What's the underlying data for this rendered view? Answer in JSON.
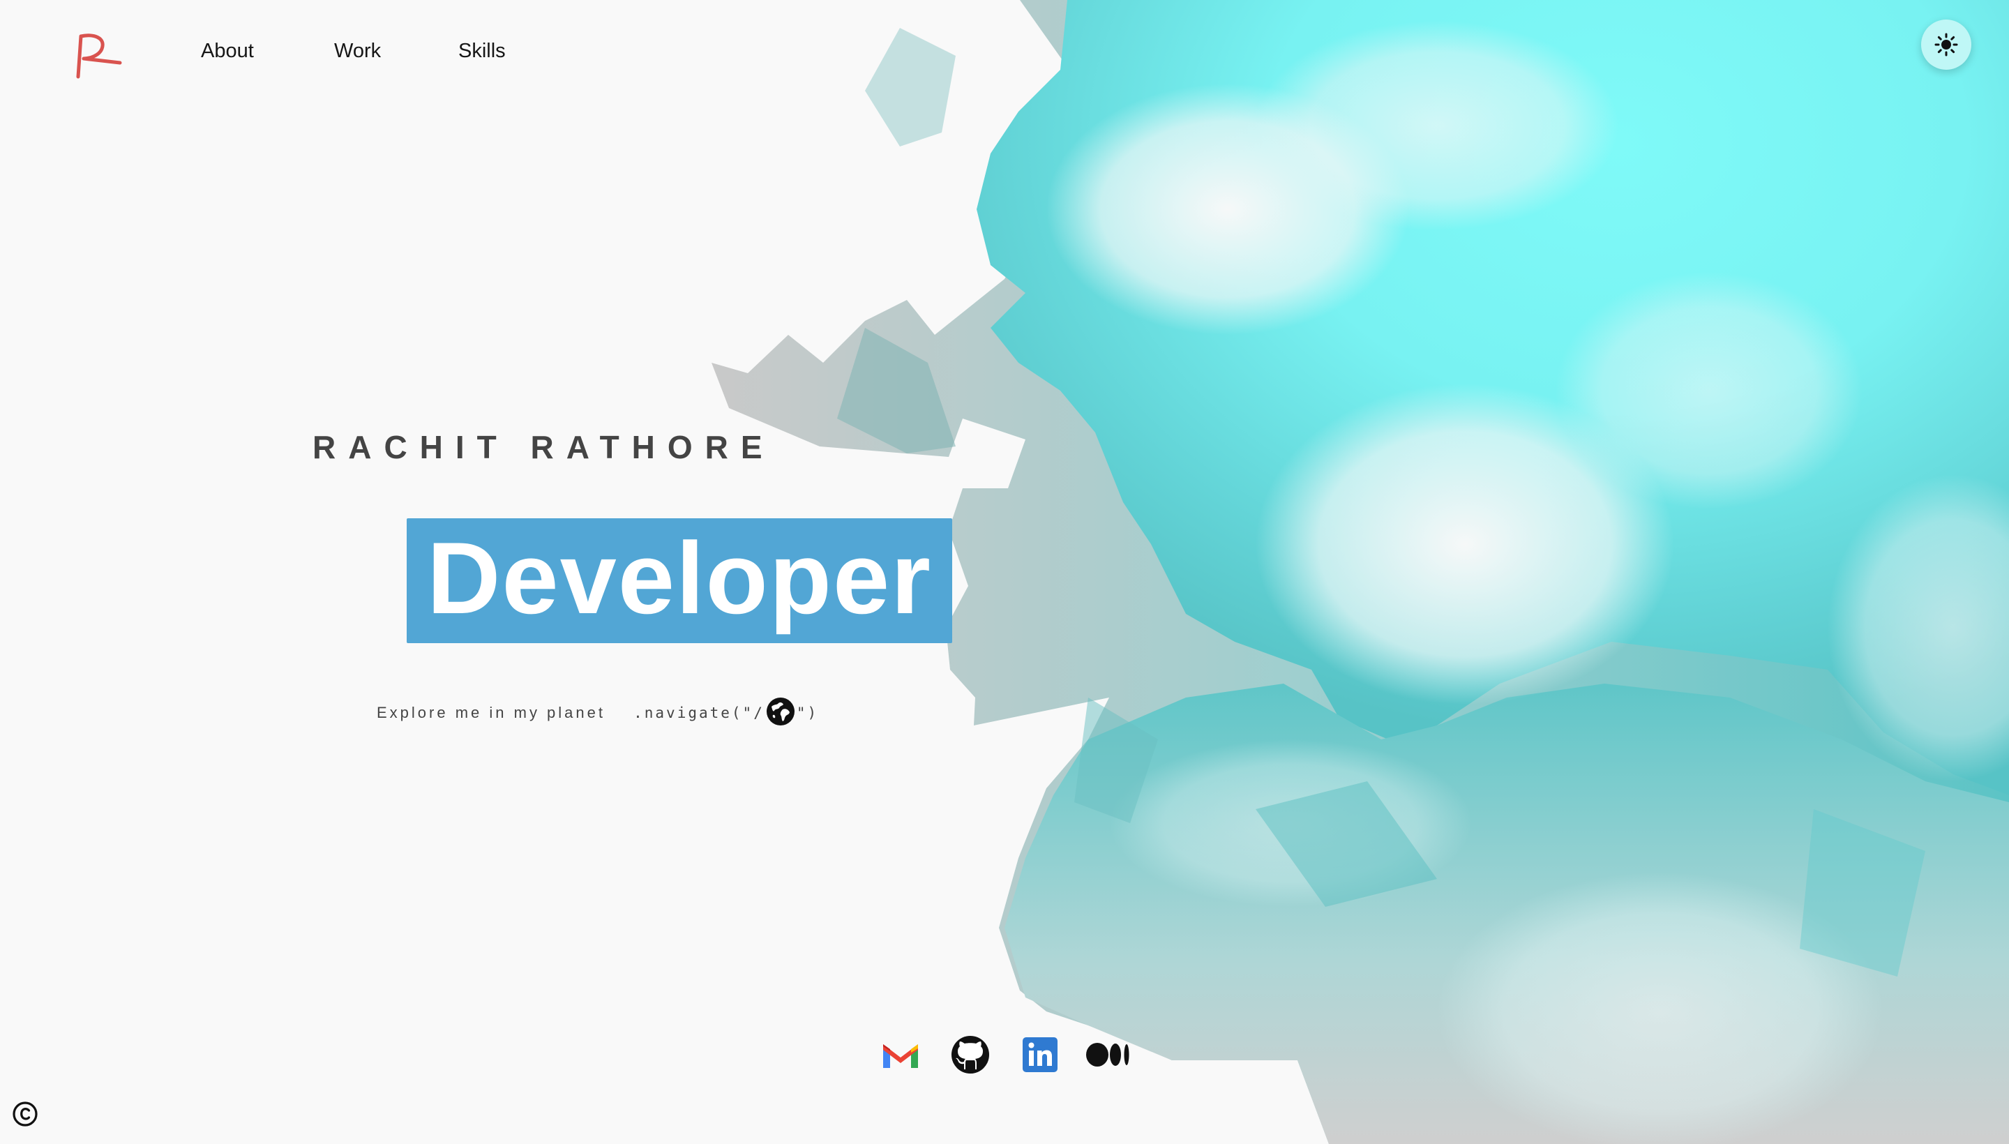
{
  "nav": {
    "logo_icon": "r-logo-icon",
    "links": [
      {
        "label": "About"
      },
      {
        "label": "Work"
      },
      {
        "label": "Skills"
      }
    ],
    "theme_toggle_icon": "sun-icon"
  },
  "hero": {
    "name": "RACHIT RATHORE",
    "role": "Developer",
    "explore_text": "Explore me in my planet",
    "navigate_prefix": ".navigate(\"/",
    "navigate_suffix": "\")",
    "globe_icon": "globe-icon"
  },
  "social": [
    {
      "icon": "gmail-icon"
    },
    {
      "icon": "github-icon"
    },
    {
      "icon": "linkedin-icon"
    },
    {
      "icon": "medium-icon"
    }
  ],
  "footer": {
    "copyright_icon": "copyright-icon"
  },
  "colors": {
    "background": "#f9f9f9",
    "accent_box": "#52a6d5",
    "logo": "#d9534f",
    "planet_light": "#7ffaf8",
    "planet_mid": "#5cc8cb",
    "planet_shadow": "#c8c8c8"
  }
}
